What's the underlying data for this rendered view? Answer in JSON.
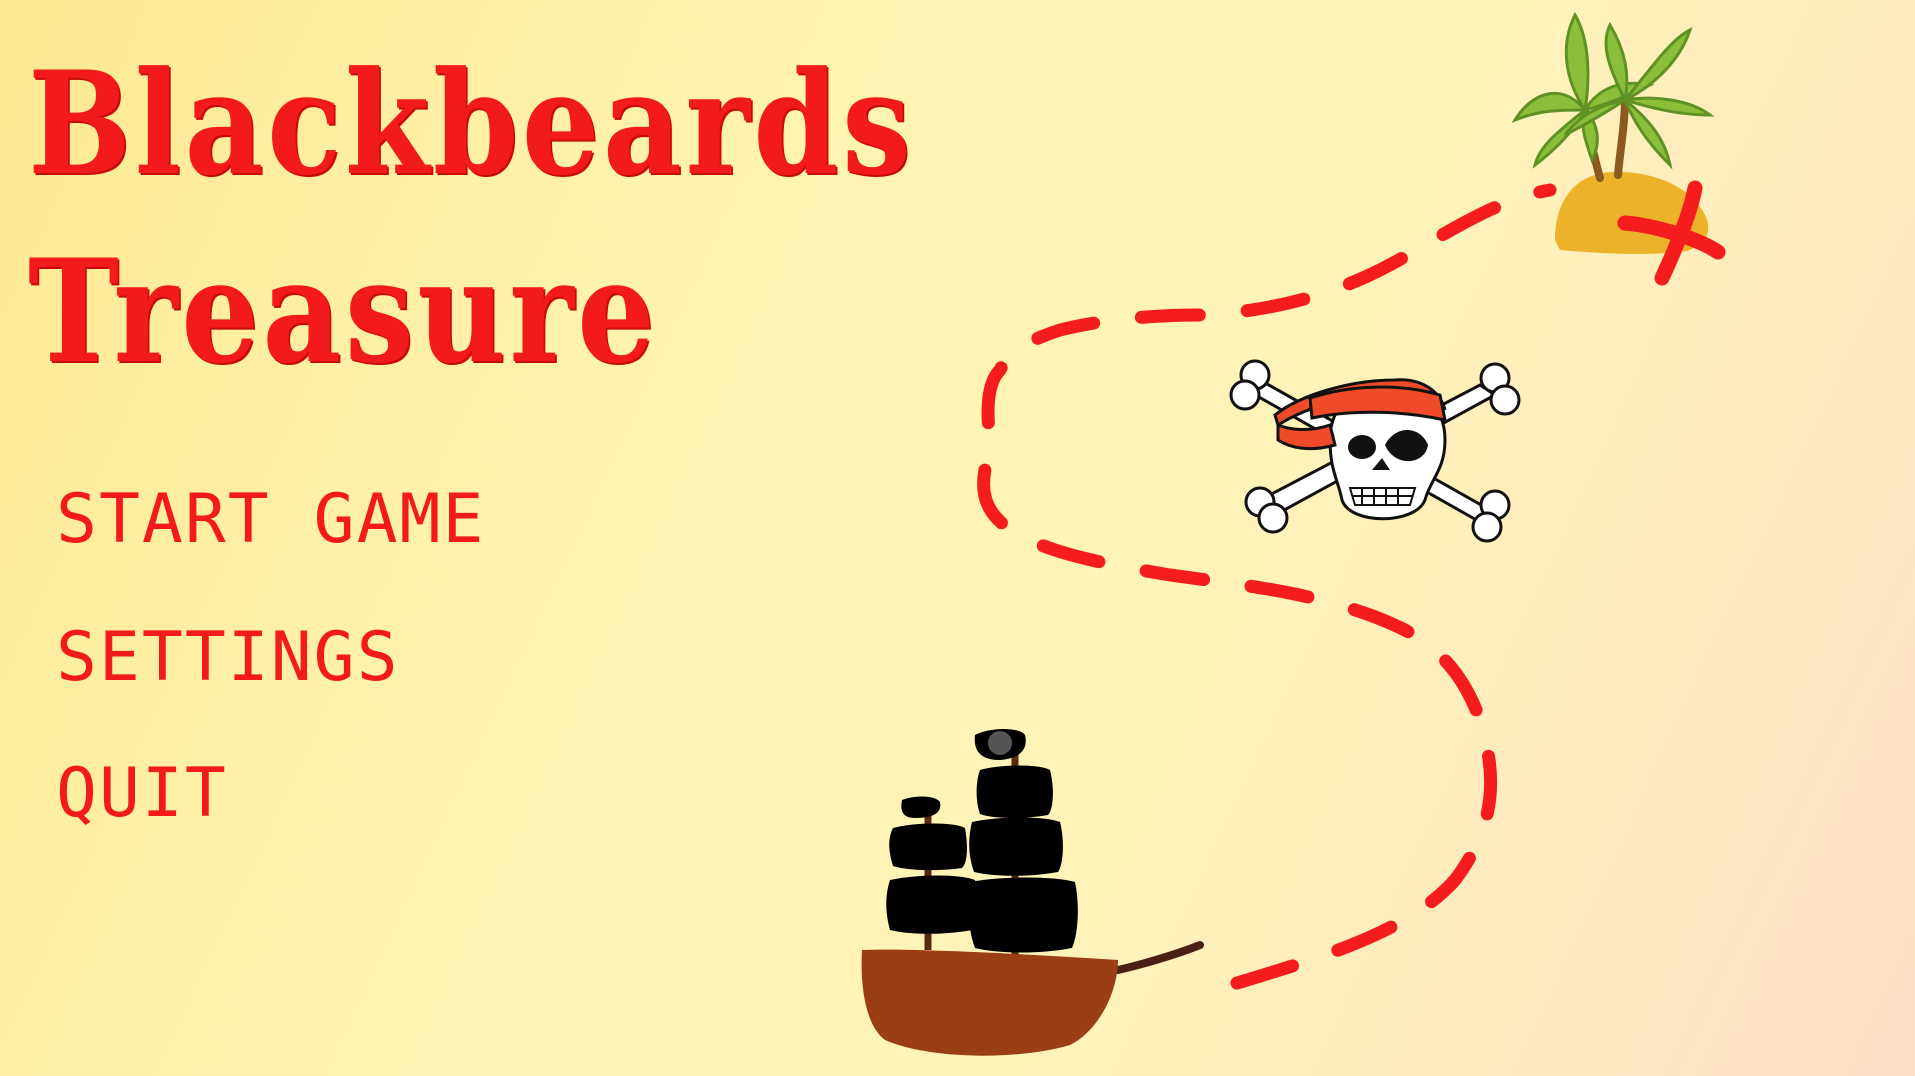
{
  "title": {
    "line1": "Blackbeards",
    "line2": "Treasure"
  },
  "menu": {
    "start_label": "START GAME",
    "settings_label": "SETTINGS",
    "quit_label": "QUIT"
  },
  "colors": {
    "text_red": "#f21a1a",
    "path_red": "#f41c1c",
    "sail_black": "#000000",
    "hull_brown": "#9a3f14",
    "island_sand": "#ecb22a",
    "palm_green": "#8bbf3a",
    "bandana_red": "#f04a2a"
  },
  "icons": [
    "island-icon",
    "skull-crossbones-icon",
    "pirate-ship-icon",
    "treasure-x-mark-icon"
  ]
}
